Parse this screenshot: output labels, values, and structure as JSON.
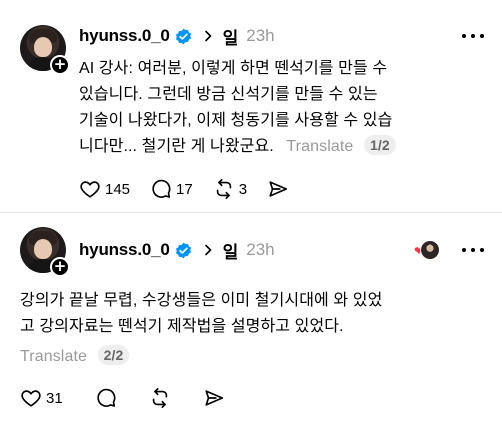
{
  "posts": [
    {
      "username": "hyunss.0_0",
      "repost_context": "일",
      "time": "23h",
      "lines": [
        "AI 강사: 여러분, 이렇게 하면 뗀석기를 만들 수",
        "있습니다. 그런데 방금 신석기를 만들 수 있는",
        "기술이 나왔다가, 이제 청동기를 사용할 수 있습",
        "니다만... 철기란 게 나왔군요."
      ],
      "translate_label": "Translate",
      "page_indicator": "1/2",
      "likes": "145",
      "replies": "17",
      "reposts": "3"
    },
    {
      "username": "hyunss.0_0",
      "repost_context": "일",
      "time": "23h",
      "lines": [
        "강의가 끝날 무렵, 수강생들은 이미 철기시대에 와 있었",
        "고 강의자료는 뗀석기 제작법을 설명하고 있었다."
      ],
      "translate_label": "Translate",
      "page_indicator": "2/2",
      "likes": "31"
    }
  ],
  "colors": {
    "verified": "#0095f6",
    "muted": "#9a9a9a",
    "heart": "#ff3040"
  },
  "icons": [
    "verified-badge-icon",
    "chevron-right-icon",
    "more-icon",
    "heart-icon",
    "comment-icon",
    "repost-icon",
    "share-icon",
    "follow-plus-icon"
  ]
}
